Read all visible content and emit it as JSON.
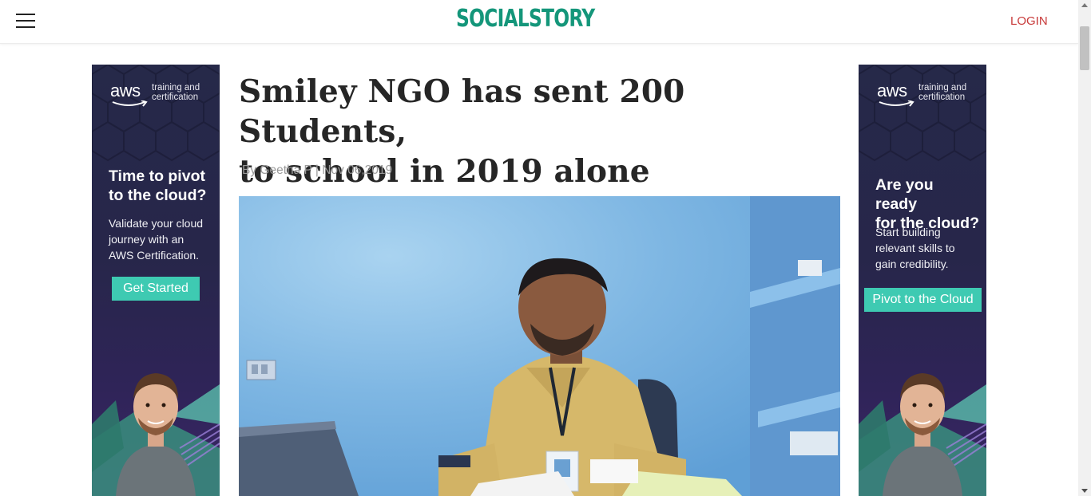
{
  "header": {
    "logo": "SOCIALSTORY",
    "login_label": "LOGIN",
    "menu_icon": "hamburger-menu-icon"
  },
  "colors": {
    "brand": "#14967a",
    "login": "#c83a3a",
    "ad_background": "#262949",
    "ad_cta": "#3ecab2",
    "headline": "#262626",
    "byline": "#9a9a9a"
  },
  "ads": {
    "left": {
      "brand": "aws",
      "tagline_line1": "training and",
      "tagline_line2": "certification",
      "title_line1": "Time to pivot",
      "title_line2": "to the cloud?",
      "body_line1": "Validate your cloud",
      "body_line2": "journey with an",
      "body_line3": "AWS Certification.",
      "cta": "Get Started"
    },
    "right": {
      "brand": "aws",
      "tagline_line1": "training and",
      "tagline_line2": "certification",
      "title_line1": "Are you ready",
      "title_line2": "for the cloud?",
      "body_line1": "Start building",
      "body_line2": "relevant skills to",
      "body_line3": "gain credibility.",
      "cta": "Pivot to the Cloud"
    }
  },
  "article": {
    "headline_line1": "Smiley NGO has sent 200 Students,",
    "headline_line2": "to school in 2019 alone",
    "byline": "By Geetha P | Nov 06,2019"
  }
}
